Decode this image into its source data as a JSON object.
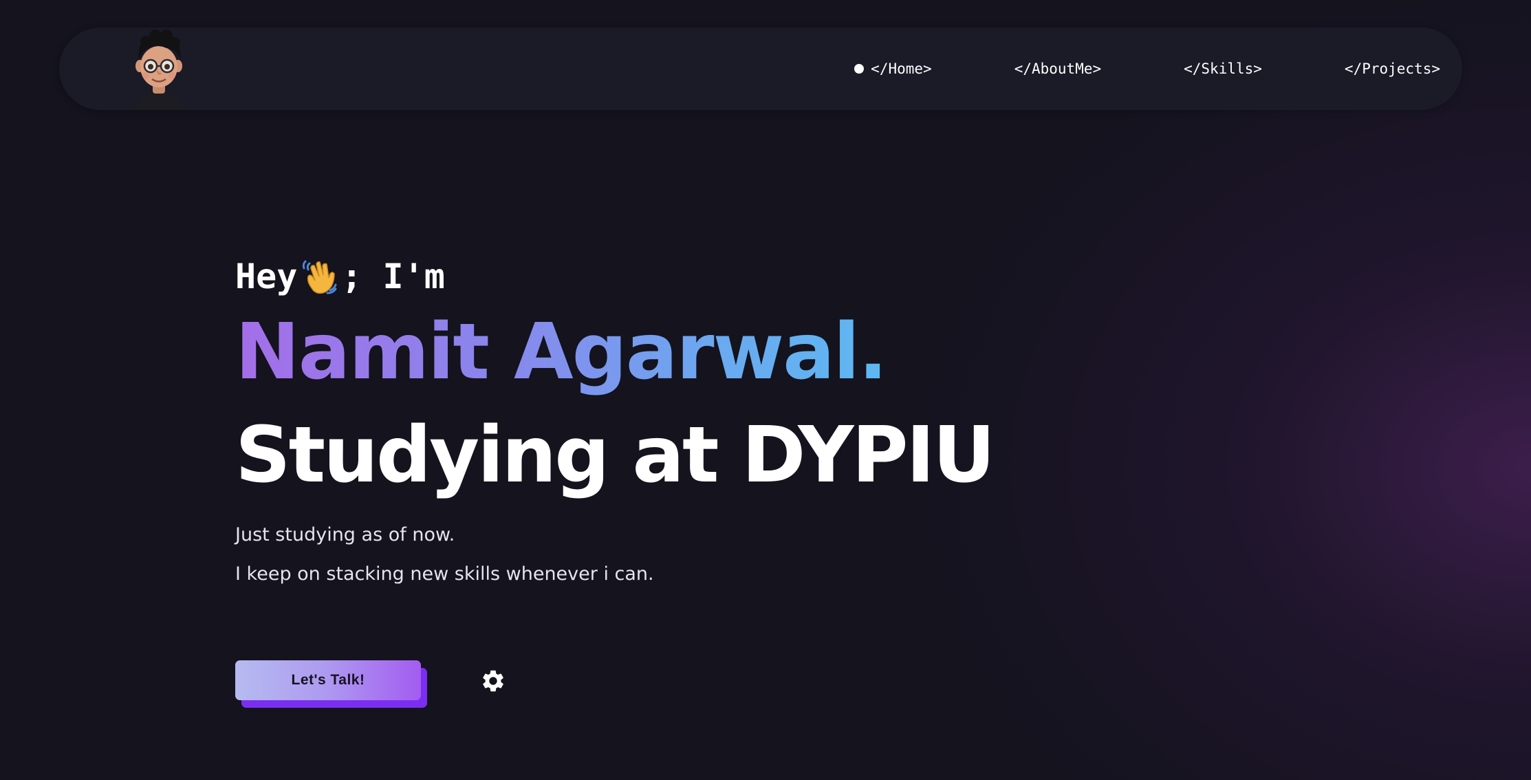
{
  "nav": {
    "avatar_icon": "cartoon-avatar-icon",
    "links": [
      {
        "label": "</Home>",
        "active": true
      },
      {
        "label": "</AboutMe>",
        "active": false
      },
      {
        "label": "</Skills>",
        "active": false
      },
      {
        "label": "</Projects>",
        "active": false
      }
    ]
  },
  "hero": {
    "greeting_prefix": "Hey",
    "greeting_icon": "waving-hand-icon",
    "greeting_suffix": "; I'm",
    "name": "Namit Agarwal.",
    "headline": "Studying at DYPIU",
    "description_lines": [
      "Just studying as of now.",
      "I keep on stacking new skills whenever i can."
    ]
  },
  "actions": {
    "talk_label": "Let's Talk!",
    "settings_icon": "gear-icon"
  },
  "colors": {
    "background": "#14131e",
    "navbar": "#1b1a27",
    "name_gradient_start": "#a46ee8",
    "name_gradient_end": "#5db8f3",
    "button_shadow": "#7a2ff0"
  }
}
